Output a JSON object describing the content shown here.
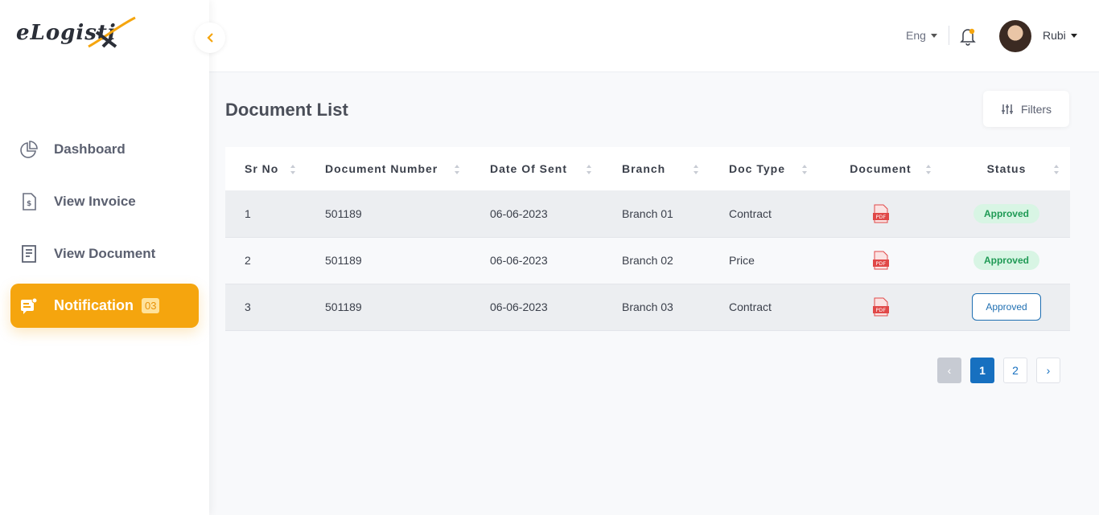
{
  "brand": {
    "logo_text": "eLogisti",
    "accent": "#f5a50e"
  },
  "sidebar": {
    "items": [
      {
        "label": "Dashboard",
        "icon": "pie-chart-icon"
      },
      {
        "label": "View Invoice",
        "icon": "invoice-icon"
      },
      {
        "label": "View Document",
        "icon": "document-icon"
      },
      {
        "label": "Notification",
        "icon": "notification-icon",
        "badge": "03",
        "active": true
      }
    ]
  },
  "header": {
    "language": "Eng",
    "user_name": "Rubi"
  },
  "main": {
    "title": "Document List",
    "filters_label": "Filters",
    "columns": [
      "Sr No",
      "Document Number",
      "Date Of Sent",
      "Branch",
      "Doc Type",
      "Document",
      "Status"
    ],
    "rows": [
      {
        "sr": "1",
        "number": "501189",
        "date": "06-06-2023",
        "branch": "Branch 01",
        "type": "Contract",
        "status": "Approved"
      },
      {
        "sr": "2",
        "number": "501189",
        "date": "06-06-2023",
        "branch": "Branch 02",
        "type": "Price",
        "status": "Approved"
      },
      {
        "sr": "3",
        "number": "501189",
        "date": "06-06-2023",
        "branch": "Branch 03",
        "type": "Contract",
        "status": "Approved"
      }
    ],
    "pagination": {
      "prev": "‹",
      "pages": [
        "1",
        "2"
      ],
      "current": "1",
      "next": "›"
    }
  },
  "colors": {
    "approved_bg": "#d8f5e4",
    "approved_text": "#1f9a55",
    "primary": "#1770c0"
  }
}
